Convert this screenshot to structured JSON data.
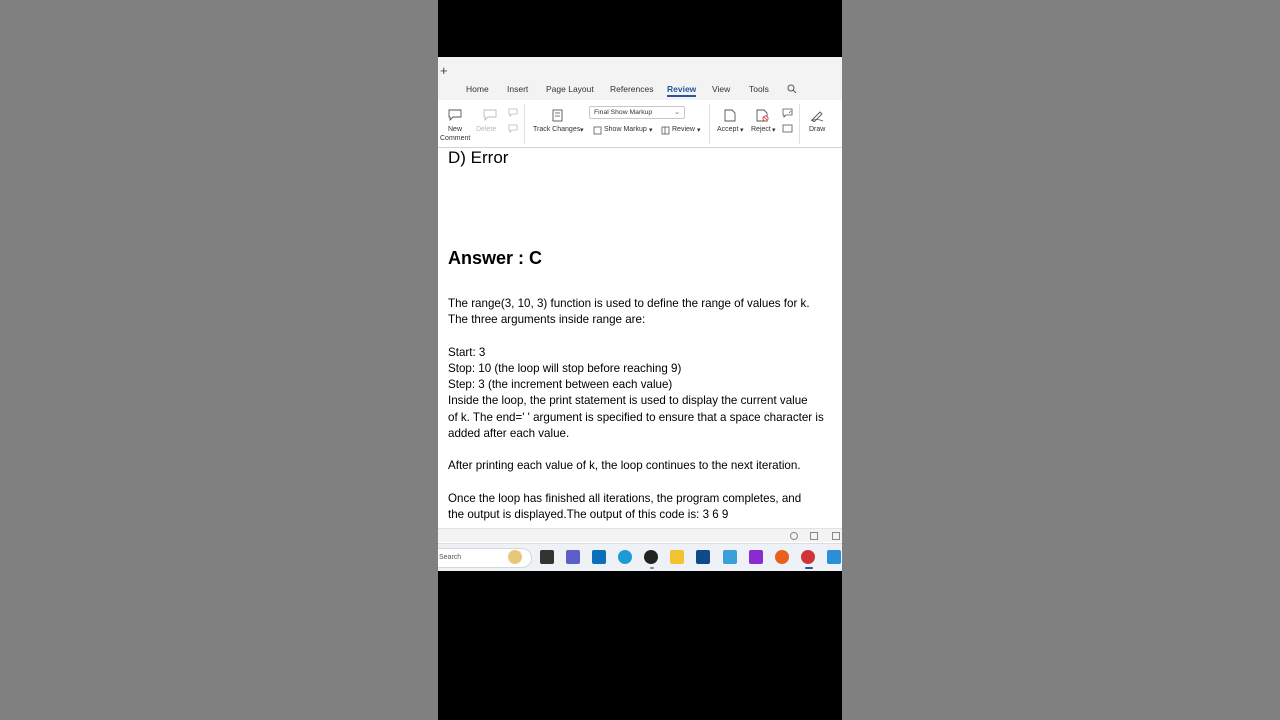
{
  "tabs": {
    "plus": "+",
    "home": "Home",
    "insert": "Insert",
    "page_layout": "Page Layout",
    "references": "References",
    "review": "Review",
    "view": "View",
    "tools": "Tools"
  },
  "ribbon": {
    "new_comment_1": "New",
    "new_comment_2": "Comment",
    "delete": "Delete",
    "track_changes": "Track Changes",
    "markup_value": "Final Show Markup",
    "show_markup": "Show Markup",
    "review": "Review",
    "accept": "Accept",
    "reject": "Reject",
    "draw": "Draw"
  },
  "document": {
    "option_d": "D) Error",
    "answer": "Answer : C",
    "lines": [
      "The range(3, 10, 3) function is used to define the range of values for k.",
      "The three arguments inside range are:",
      "Start: 3",
      "Stop: 10 (the loop will stop before reaching 9)",
      "Step: 3 (the increment between each value)",
      "Inside the loop, the print statement is used to display the current value",
      "of k. The end=' ' argument is specified to ensure that a space character is",
      "added after each value.",
      "After printing each value of k, the loop continues to the next iteration.",
      "Once the loop has finished all iterations, the program completes, and",
      "the output is displayed.The output of this code is: 3 6 9"
    ]
  },
  "taskbar": {
    "search_text": "Search"
  },
  "colors": {
    "accent": "#2b579a",
    "background": "#808080"
  }
}
